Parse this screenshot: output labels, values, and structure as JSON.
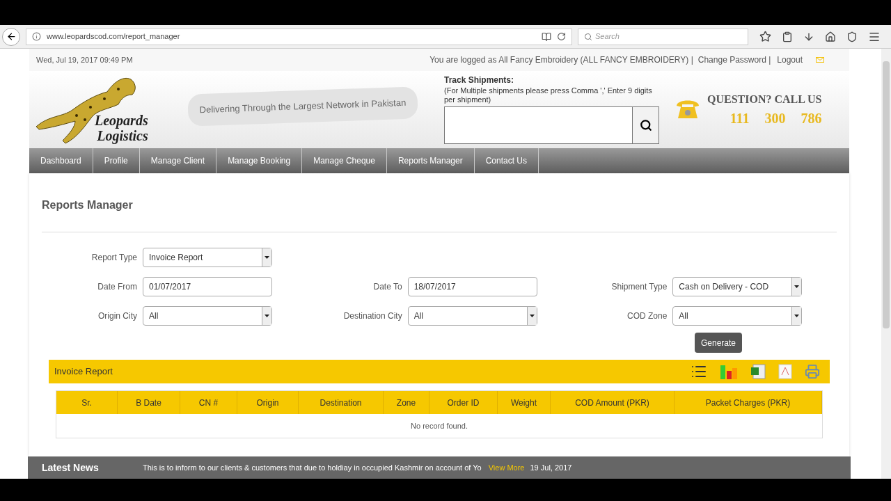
{
  "browser": {
    "url": "www.leopardscod.com/report_manager",
    "search_placeholder": "Search"
  },
  "header": {
    "date": "Wed, Jul 19, 2017 09:49 PM",
    "logged_text": "You are logged as All Fancy Embroidery (ALL FANCY EMBROIDERY) |",
    "links": [
      "Change Password |",
      "Logout"
    ],
    "logo_lines": [
      "Leopards",
      "Logistics"
    ],
    "tagline": "Delivering Through the Largest Network in Pakistan"
  },
  "track": {
    "title": "Track Shipments:",
    "hint": "(For Multiple shipments please press Comma ',' Enter 9 digits per shipment)"
  },
  "call": {
    "title": "QUESTION? CALL US",
    "numbers": [
      "111",
      "300",
      "786"
    ]
  },
  "nav": [
    "Dashboard",
    "Profile",
    "Manage Client",
    "Manage Booking",
    "Manage Cheque",
    "Reports Manager",
    "Contact Us"
  ],
  "page_title": "Reports Manager",
  "form": {
    "rows": [
      [
        {
          "label": "Report Type",
          "kind": "select",
          "value": "Invoice Report"
        }
      ],
      [
        {
          "label": "Date From",
          "kind": "date",
          "value": "01/07/2017"
        },
        {
          "label": "Date To",
          "kind": "date",
          "value": "18/07/2017"
        },
        {
          "label": "Shipment Type",
          "kind": "select",
          "value": "Cash on Delivery - COD"
        }
      ],
      [
        {
          "label": "Origin City",
          "kind": "select",
          "value": "All"
        },
        {
          "label": "Destination City",
          "kind": "select",
          "value": "All"
        },
        {
          "label": "COD Zone",
          "kind": "select",
          "value": "All"
        }
      ]
    ],
    "button": "Generate"
  },
  "report": {
    "title": "Invoice Report",
    "columns": [
      "Sr.",
      "B Date",
      "CN #",
      "Origin",
      "Destination",
      "Zone",
      "Order ID",
      "Weight",
      "COD Amount (PKR)",
      "Packet Charges (PKR)"
    ],
    "empty": "No record found."
  },
  "news": {
    "title": "Latest News",
    "text": "This is to inform to our clients & customers that due to holdiay in occupied Kashmir on account of Yo",
    "link": "View More",
    "date": "19 Jul, 2017"
  }
}
